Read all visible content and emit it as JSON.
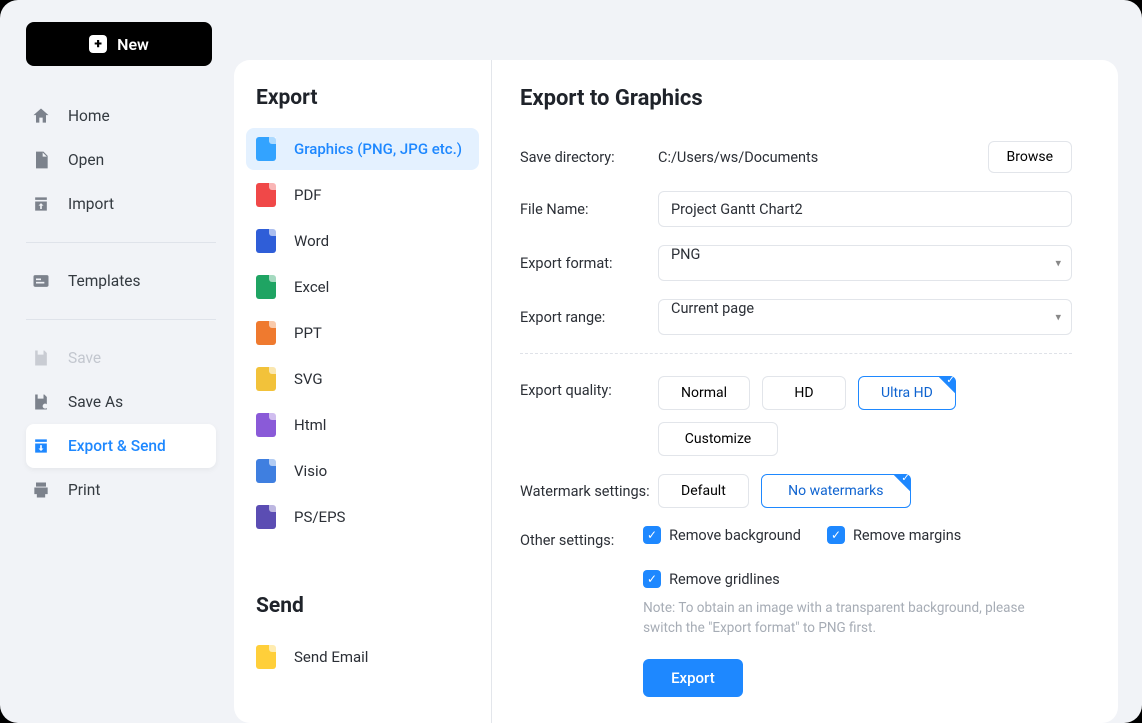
{
  "newButton": {
    "label": "New"
  },
  "sidebar": {
    "items": [
      {
        "label": "Home",
        "icon": "home-icon",
        "state": ""
      },
      {
        "label": "Open",
        "icon": "open-icon",
        "state": ""
      },
      {
        "label": "Import",
        "icon": "import-icon",
        "state": ""
      }
    ],
    "items2": [
      {
        "label": "Templates",
        "icon": "templates-icon",
        "state": ""
      }
    ],
    "items3": [
      {
        "label": "Save",
        "icon": "save-icon",
        "state": "disabled"
      },
      {
        "label": "Save As",
        "icon": "saveas-icon",
        "state": ""
      },
      {
        "label": "Export & Send",
        "icon": "export-icon",
        "state": "active"
      },
      {
        "label": "Print",
        "icon": "print-icon",
        "state": ""
      }
    ]
  },
  "middle": {
    "exportHeading": "Export",
    "sendHeading": "Send",
    "exportItems": [
      {
        "label": "Graphics (PNG, JPG etc.)",
        "color": "blue",
        "active": true
      },
      {
        "label": "PDF",
        "color": "red"
      },
      {
        "label": "Word",
        "color": "dblue"
      },
      {
        "label": "Excel",
        "color": "green"
      },
      {
        "label": "PPT",
        "color": "orange"
      },
      {
        "label": "SVG",
        "color": "yellow"
      },
      {
        "label": "Html",
        "color": "purple"
      },
      {
        "label": "Visio",
        "color": "lblue"
      },
      {
        "label": "PS/EPS",
        "color": "dpurple"
      }
    ],
    "sendItems": [
      {
        "label": "Send Email",
        "color": "env"
      }
    ]
  },
  "main": {
    "title": "Export to Graphics",
    "labels": {
      "saveDir": "Save directory:",
      "fileName": "File Name:",
      "exportFormat": "Export format:",
      "exportRange": "Export range:",
      "exportQuality": "Export quality:",
      "watermark": "Watermark settings:",
      "other": "Other settings:"
    },
    "values": {
      "saveDir": "C:/Users/ws/Documents",
      "fileName": "Project Gantt Chart2",
      "exportFormat": "PNG",
      "exportRange": "Current page"
    },
    "buttons": {
      "browse": "Browse",
      "customize": "Customize",
      "export": "Export"
    },
    "quality": {
      "normal": "Normal",
      "hd": "HD",
      "ultra": "Ultra HD",
      "selected": "ultra"
    },
    "watermark": {
      "default": "Default",
      "none": "No watermarks",
      "selected": "none"
    },
    "checks": {
      "removeBg": "Remove background",
      "removeMargins": "Remove margins",
      "removeGridlines": "Remove gridlines"
    },
    "note": "Note: To obtain an image with a transparent background, please switch the \"Export format\" to PNG first."
  }
}
